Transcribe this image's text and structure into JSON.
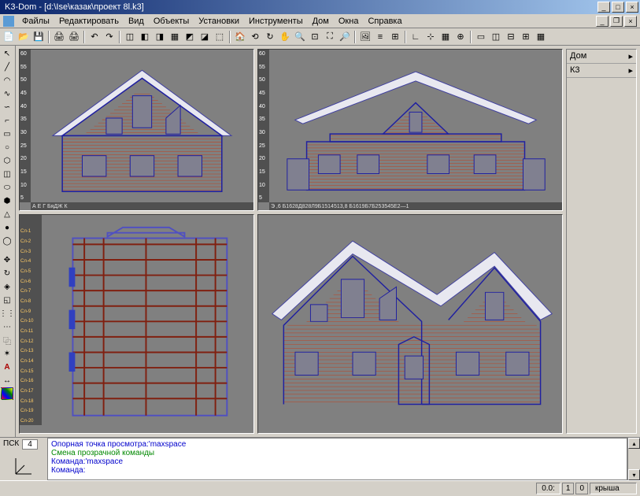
{
  "title": "K3-Dom - [d:\\Ise\\казак\\проект 8l.k3]",
  "menu": [
    "Файлы",
    "Редактировать",
    "Вид",
    "Объекты",
    "Установки",
    "Инструменты",
    "Дом",
    "Окна",
    "Справка"
  ],
  "side": {
    "tab1": "Дом",
    "tab2": "К3"
  },
  "ruler_v": [
    "5",
    "10",
    "15",
    "20",
    "25",
    "30",
    "35",
    "40",
    "45",
    "50",
    "55",
    "60"
  ],
  "ruler_h1": "А      Е         Г        БяДЖ         К",
  "ruler_h2": "Э      ,6 Б1628Д828Л9Б1514513,8 Б1619Б7Б253545Е2—1",
  "plan_rows": [
    "Сл-20",
    "Сл-19",
    "Сл-18",
    "Сл-17",
    "Сл-16",
    "Сл-15",
    "Сл-14",
    "Сл-13",
    "Сл-12",
    "Сл-11",
    "Сл-10",
    "Сл-9",
    "Сл-8",
    "Сл-7",
    "Сл-6",
    "Сл-5",
    "Сл-4",
    "Сл-3",
    "Сл-2",
    "Сл-1"
  ],
  "cmd": {
    "psk": "ПСК",
    "psk_n": "4",
    "l1": "Опорная точка просмотра:'maxspace",
    "l2": "Смена прозрачной команды",
    "l3": "Команда:'maxspace",
    "l4": "Команда:"
  },
  "status": {
    "zero": "0.0:",
    "one": "1",
    "two": "0",
    "layer": "крыша"
  },
  "colors": {
    "brick": "#c04020",
    "outline": "#2020a0"
  }
}
